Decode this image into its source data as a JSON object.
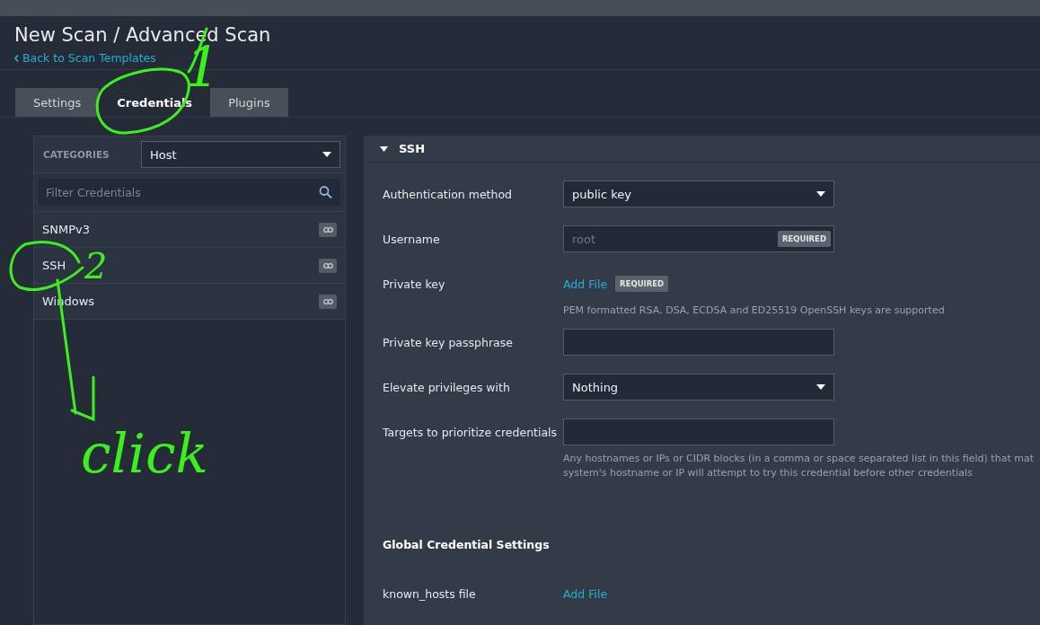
{
  "page": {
    "title": "New Scan / Advanced Scan",
    "back_link": "Back to Scan Templates"
  },
  "tabs": [
    {
      "label": "Settings",
      "selected": false
    },
    {
      "label": "Credentials",
      "selected": true
    },
    {
      "label": "Plugins",
      "selected": false
    }
  ],
  "sidebar": {
    "categories_label": "CATEGORIES",
    "category": "Host",
    "filter": {
      "placeholder": "Filter Credentials"
    },
    "items": [
      {
        "label": "SNMPv3"
      },
      {
        "label": "SSH"
      },
      {
        "label": "Windows"
      }
    ]
  },
  "section": {
    "title": "SSH",
    "expanded": true,
    "fields": [
      {
        "kind": "select",
        "label": "Authentication method",
        "value": "public key"
      },
      {
        "kind": "input",
        "label": "Username",
        "placeholder": "root",
        "badge": "REQUIRED"
      },
      {
        "kind": "file",
        "label": "Private key",
        "link": "Add File",
        "badge": "REQUIRED",
        "help": "PEM formatted RSA, DSA, ECDSA and ED25519 OpenSSH keys are supported"
      },
      {
        "kind": "input",
        "label": "Private key passphrase"
      },
      {
        "kind": "select",
        "label": "Elevate privileges with",
        "value": "Nothing"
      },
      {
        "kind": "input",
        "label": "Targets to prioritize credentials",
        "help": "Any hostnames or IPs or CIDR blocks (in a comma or space separated list in this field) that mat\nsystem's hostname or IP will attempt to try this credential before other credentials"
      }
    ],
    "global_title": "Global Credential Settings",
    "global_fields": [
      {
        "kind": "file",
        "label": "known_hosts file",
        "link": "Add File"
      }
    ]
  },
  "annotations": [
    {
      "text": "1"
    },
    {
      "text": "2"
    },
    {
      "text": "click"
    }
  ]
}
